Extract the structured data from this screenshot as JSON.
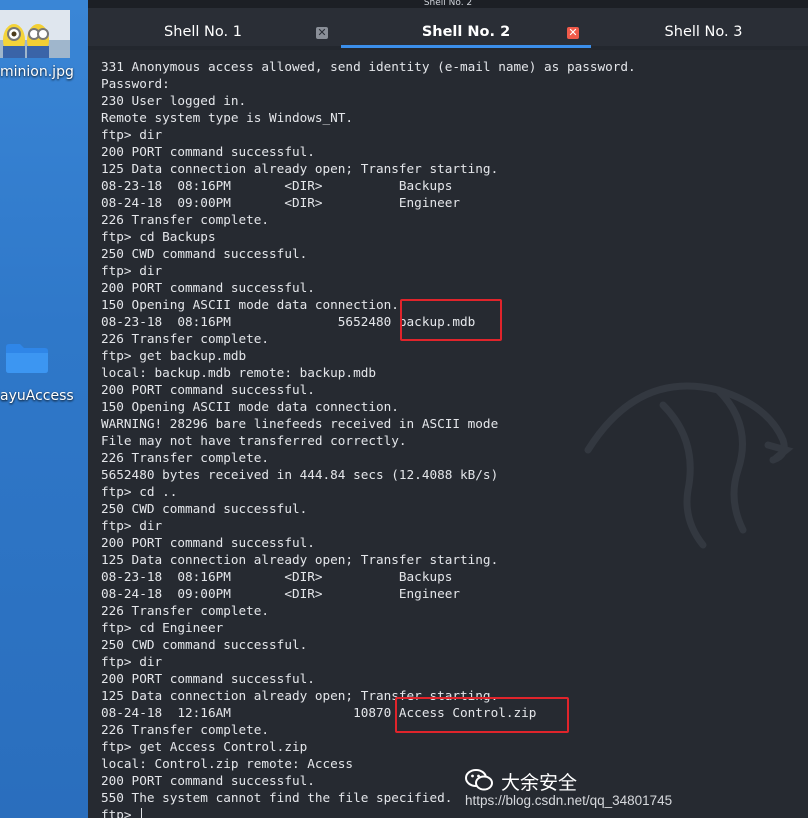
{
  "desktop": {
    "file_label": "minion.jpg",
    "folder_label": "ayuAccess"
  },
  "window": {
    "title": "Shell No. 2",
    "tabs": [
      {
        "label": "Shell No. 1",
        "active": false
      },
      {
        "label": "Shell No. 2",
        "active": true
      },
      {
        "label": "Shell No. 3",
        "active": false
      }
    ],
    "close_glyph": "✕"
  },
  "terminal": {
    "lines": [
      "331 Anonymous access allowed, send identity (e-mail name) as password.",
      "Password:",
      "230 User logged in.",
      "Remote system type is Windows_NT.",
      "ftp> dir",
      "200 PORT command successful.",
      "125 Data connection already open; Transfer starting.",
      "08-23-18  08:16PM       <DIR>          Backups",
      "08-24-18  09:00PM       <DIR>          Engineer",
      "226 Transfer complete.",
      "ftp> cd Backups",
      "250 CWD command successful.",
      "ftp> dir",
      "200 PORT command successful.",
      "150 Opening ASCII mode data connection.",
      "08-23-18  08:16PM              5652480 backup.mdb",
      "226 Transfer complete.",
      "ftp> get backup.mdb",
      "local: backup.mdb remote: backup.mdb",
      "200 PORT command successful.",
      "150 Opening ASCII mode data connection.",
      "WARNING! 28296 bare linefeeds received in ASCII mode",
      "File may not have transferred correctly.",
      "226 Transfer complete.",
      "5652480 bytes received in 444.84 secs (12.4088 kB/s)",
      "ftp> cd ..",
      "250 CWD command successful.",
      "ftp> dir",
      "200 PORT command successful.",
      "125 Data connection already open; Transfer starting.",
      "08-23-18  08:16PM       <DIR>          Backups",
      "08-24-18  09:00PM       <DIR>          Engineer",
      "226 Transfer complete.",
      "ftp> cd Engineer",
      "250 CWD command successful.",
      "ftp> dir",
      "200 PORT command successful.",
      "125 Data connection already open; Transfer starting.",
      "08-24-18  12:16AM                10870 Access Control.zip",
      "226 Transfer complete.",
      "ftp> get Access Control.zip",
      "local: Control.zip remote: Access",
      "200 PORT command successful.",
      "550 The system cannot find the file specified."
    ],
    "prompt": "ftp> "
  },
  "watermark": {
    "name": "大余安全",
    "url": "https://blog.csdn.net/qq_34801745"
  },
  "colors": {
    "highlight": "#e0242b",
    "tab_accent": "#3b8eea"
  }
}
